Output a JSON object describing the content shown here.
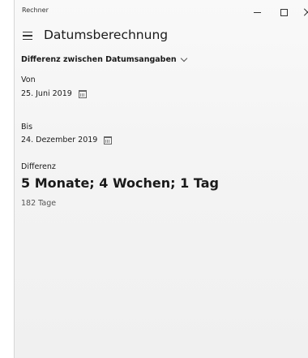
{
  "app": {
    "title": "Rechner"
  },
  "header": {
    "page_title": "Datumsberechnung",
    "menu_icon": "hamburger-menu-icon"
  },
  "mode": {
    "selected": "Differenz zwischen Datumsangaben",
    "icon": "chevron-down-icon"
  },
  "from": {
    "label": "Von",
    "value": "25. Juni 2019",
    "icon": "calendar-icon"
  },
  "to": {
    "label": "Bis",
    "value": "24. Dezember 2019",
    "icon": "calendar-icon"
  },
  "result": {
    "label": "Differenz",
    "value": "5 Monate; 4 Wochen; 1 Tag",
    "days": "182 Tage"
  },
  "window_controls": {
    "minimize": "minimize-icon",
    "maximize": "maximize-icon",
    "close": "close-icon"
  }
}
